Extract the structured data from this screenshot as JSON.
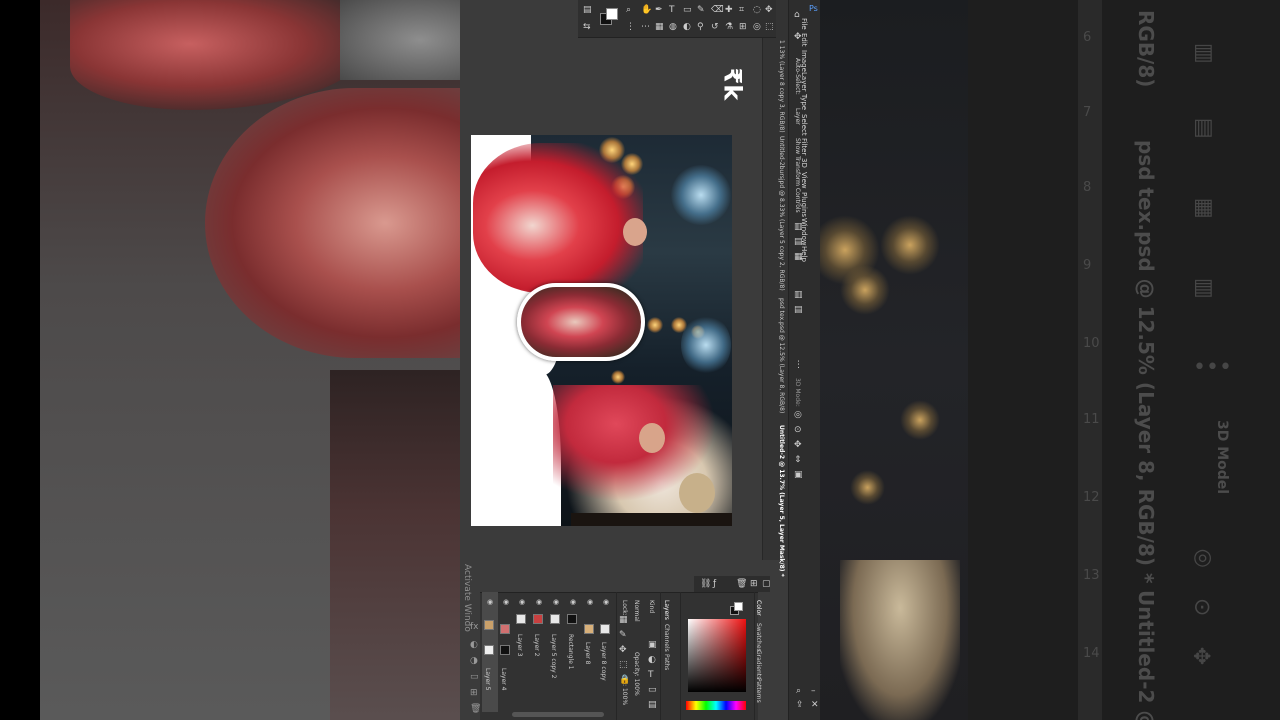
{
  "background": {
    "far_right": {
      "ruler_ticks": [
        "6",
        "7",
        "8",
        "9",
        "10",
        "11",
        "12",
        "13",
        "14"
      ],
      "doc_title_1": "psd tex.psd @ 12.5% (Layer 8, RGB/8) *",
      "doc_title_2": "Untitled-2 @",
      "partial_1": "RGB/8)",
      "partial_2": "3D Model"
    }
  },
  "menu": {
    "items": [
      "File",
      "Edit",
      "Image",
      "Layer",
      "Type",
      "Select",
      "Filter",
      "3D",
      "View",
      "Plugins",
      "Window",
      "Help"
    ]
  },
  "options_bar": {
    "auto_select": "Auto-Select:",
    "layer_label": "Layer",
    "transform_controls": "Show Transform Controls",
    "mode_3d": "3D Mode:"
  },
  "tabs": [
    "Untitled-2 @ 13.7% (Layer 5, Layer Mask/8) *",
    "psd tex.psd @ 12.5% (Layer 8, RGB/8)",
    "Untitled-2bursjpd @ 8.33% (Layer 5 copy 2, RGB/8)",
    "1 13% (Layer 8 copy 3, RGB/8)"
  ],
  "watermark": "₹k",
  "status": "Activate Windo",
  "panels": {
    "color": {
      "tabs": [
        "Color",
        "Swatches",
        "Gradients",
        "Patterns"
      ]
    },
    "layers": {
      "tabs": [
        "Layers",
        "Channels",
        "Paths"
      ],
      "kind": "Kind",
      "blend": "Normal",
      "opacity": "Opacity: 100%",
      "fill": "Fill: 100%",
      "lock": "Lock:",
      "items": [
        "Layer 8 copy",
        "Layer 8",
        "Rectangle 1",
        "Layer 5 copy 2",
        "Layer 2",
        "Layer 3",
        "Layer 4",
        "Layer 5"
      ]
    }
  },
  "colors": {
    "accent_red": "#e02030",
    "panel_bg": "#323232",
    "menu_bg": "#2d2d2d"
  }
}
